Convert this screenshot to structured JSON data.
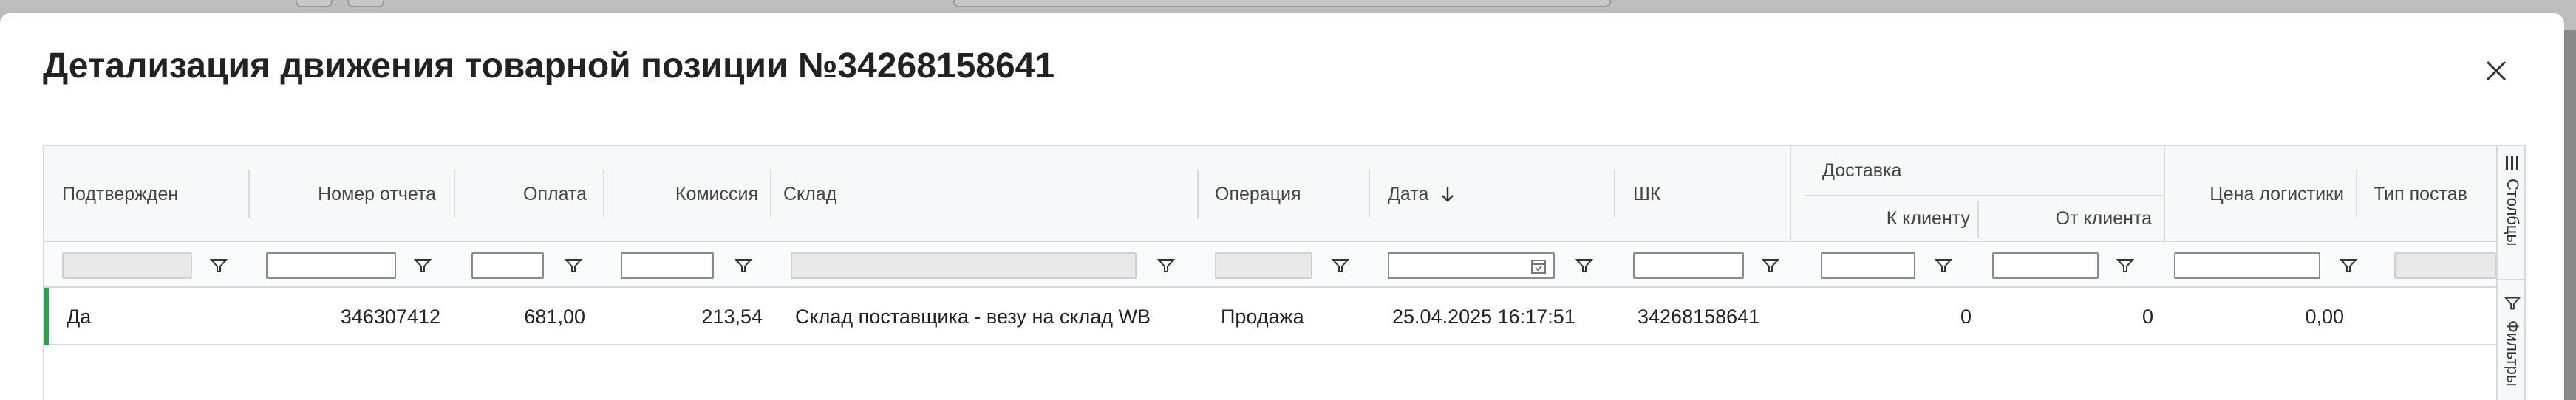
{
  "modal": {
    "title": "Детализация движения товарной позиции №34268158641",
    "close_icon": "close-icon"
  },
  "grid": {
    "columns": {
      "confirmed": "Подтвержден",
      "report_number": "Номер отчета",
      "payment": "Оплата",
      "commission": "Комиссия",
      "warehouse": "Склад",
      "operation": "Операция",
      "date": "Дата",
      "barcode": "ШК",
      "delivery_group": "Доставка",
      "to_client": "К клиенту",
      "from_client": "От клиента",
      "logistics_price": "Цена логистики",
      "supply_type": "Тип постав"
    },
    "sort": {
      "column": "Дата",
      "direction": "desc",
      "icon": "arrow-down-icon"
    },
    "rows": [
      {
        "confirmed": "Да",
        "report_number": "346307412",
        "payment": "681,00",
        "commission": "213,54",
        "warehouse": "Склад поставщика - везу на склад WB",
        "operation": "Продажа",
        "date": "25.04.2025 16:17:51",
        "barcode": "34268158641",
        "to_client": "0",
        "from_client": "0",
        "logistics_price": "0,00"
      }
    ],
    "row_marker_color": "#2e9e4f"
  },
  "side_panel": {
    "columns_tab": "Столбцы",
    "filters_tab": "Фильтры"
  }
}
